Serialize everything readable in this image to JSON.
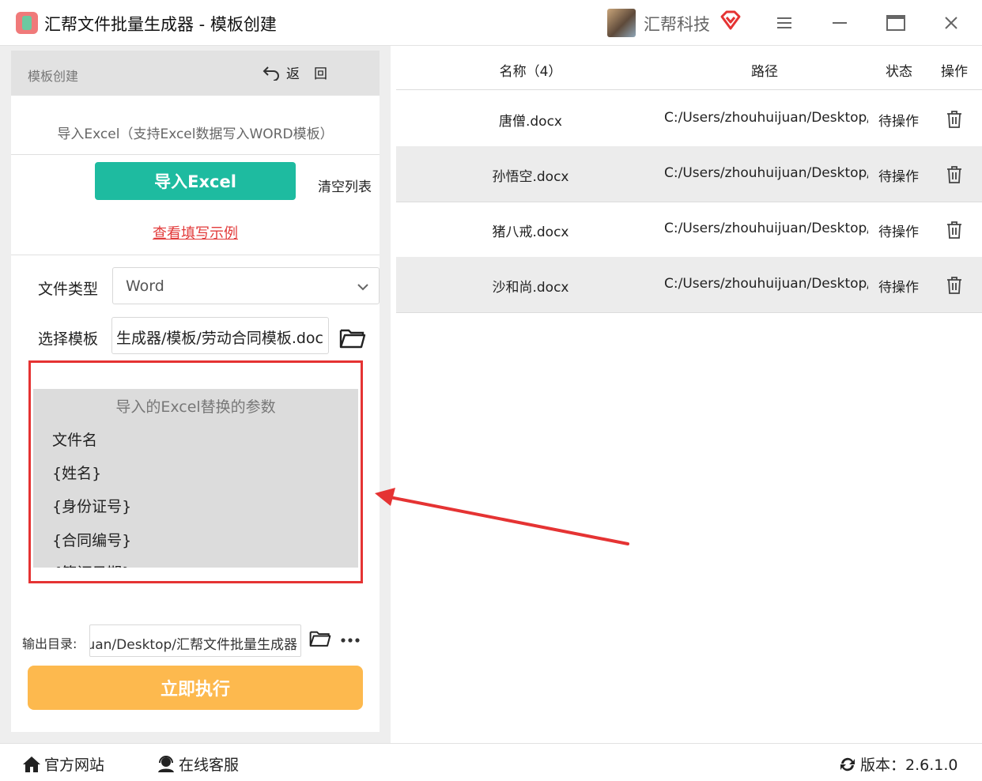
{
  "app": {
    "title": "汇帮文件批量生成器 - 模板创建",
    "brand": "汇帮科技",
    "accent": "#1ebba0",
    "run_color": "#fdb94e"
  },
  "left": {
    "header_title": "模板创建",
    "back_label": "返回",
    "excel_hint": "导入Excel（支持Excel数据写入WORD模板）",
    "import_button": "导入Excel",
    "clear_list": "清空列表",
    "example_link": "查看填写示例",
    "file_type_label": "文件类型",
    "file_type_value": "Word",
    "template_label": "选择模板",
    "template_value": "生成器/模板/劳动合同模板.doc",
    "params_title": "导入的Excel替换的参数",
    "params": [
      "文件名",
      "{姓名}",
      "{身份证号}",
      "{合同编号}",
      "{签订日期}"
    ],
    "output_label": "输出目录:",
    "output_value": "uan/Desktop/汇帮文件批量生成器",
    "run_button": "立即执行"
  },
  "table": {
    "headers": {
      "name": "名称（4）",
      "path": "路径",
      "status": "状态",
      "action": "操作"
    },
    "rows": [
      {
        "name": "唐僧.docx",
        "path": "C:/Users/zhouhuijuan/Desktop/",
        "status": "待操作"
      },
      {
        "name": "孙悟空.docx",
        "path": "C:/Users/zhouhuijuan/Desktop/",
        "status": "待操作"
      },
      {
        "name": "猪八戒.docx",
        "path": "C:/Users/zhouhuijuan/Desktop/",
        "status": "待操作"
      },
      {
        "name": "沙和尚.docx",
        "path": "C:/Users/zhouhuijuan/Desktop/",
        "status": "待操作"
      }
    ]
  },
  "footer": {
    "website": "官方网站",
    "support": "在线客服",
    "version": "版本：2.6.1.0"
  }
}
